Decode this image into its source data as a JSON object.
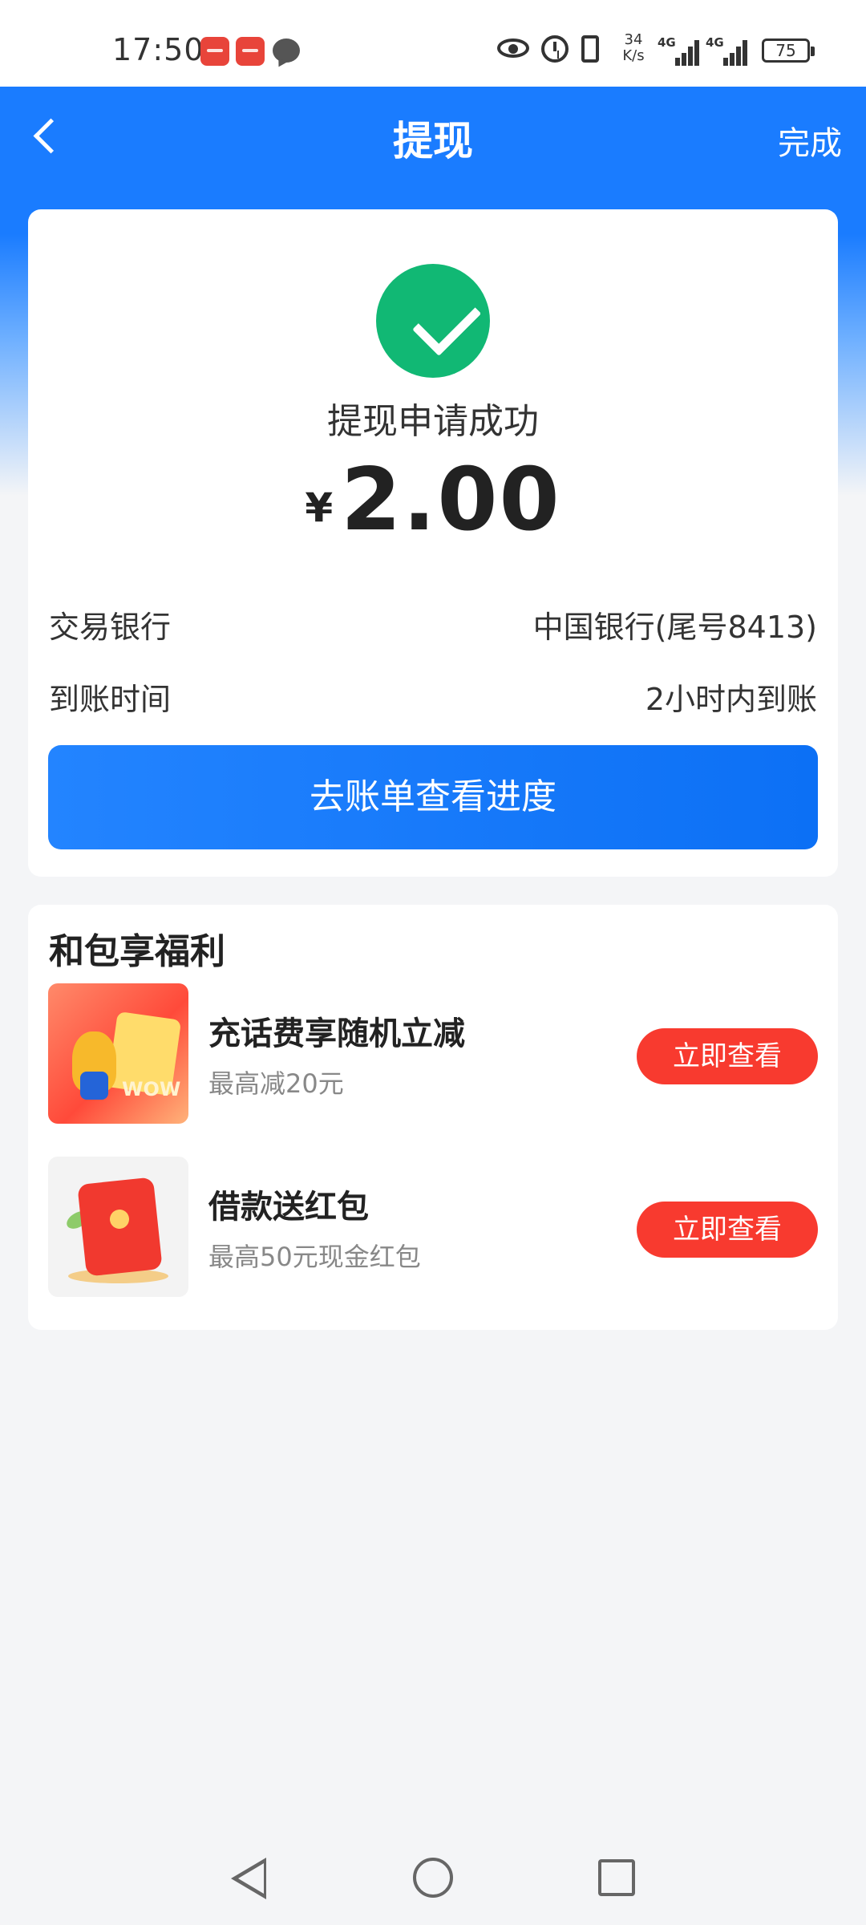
{
  "status_bar": {
    "time": "17:50",
    "net_speed_value": "34",
    "net_speed_unit": "K/s",
    "signal_1": "4G",
    "signal_2": "4G",
    "battery": "75"
  },
  "header": {
    "title": "提现",
    "done_label": "完成"
  },
  "result": {
    "status_text": "提现申请成功",
    "currency_symbol": "¥",
    "amount": "2.00",
    "rows": [
      {
        "label": "交易银行",
        "value": "中国银行(尾号8413)"
      },
      {
        "label": "到账时间",
        "value": "2小时内到账"
      }
    ],
    "button_label": "去账单查看进度"
  },
  "benefits": {
    "title": "和包享福利",
    "items": [
      {
        "name": "充话费享随机立减",
        "desc": "最高减20元",
        "button": "立即查看",
        "badge": "WOW"
      },
      {
        "name": "借款送红包",
        "desc": "最高50元现金红包",
        "button": "立即查看"
      }
    ]
  },
  "colors": {
    "brand_blue": "#1a7cff",
    "success_green": "#11b874",
    "cta_red": "#f83a2f"
  }
}
